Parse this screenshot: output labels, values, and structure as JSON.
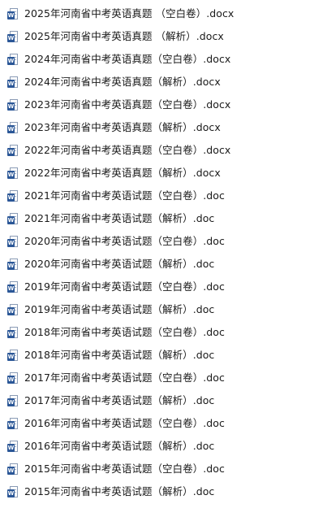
{
  "files": [
    {
      "name": "2025年河南省中考英语真题 （空白卷）.docx",
      "icon": "word-document-icon"
    },
    {
      "name": "2025年河南省中考英语真题 （解析）.docx",
      "icon": "word-document-icon"
    },
    {
      "name": "2024年河南省中考英语真题（空白卷）.docx",
      "icon": "word-document-icon"
    },
    {
      "name": "2024年河南省中考英语真题（解析）.docx",
      "icon": "word-document-icon"
    },
    {
      "name": "2023年河南省中考英语真题（空白卷）.docx",
      "icon": "word-document-icon"
    },
    {
      "name": "2023年河南省中考英语真题（解析）.docx",
      "icon": "word-document-icon"
    },
    {
      "name": "2022年河南省中考英语真题（空白卷）.docx",
      "icon": "word-document-icon"
    },
    {
      "name": "2022年河南省中考英语真题（解析）.docx",
      "icon": "word-document-icon"
    },
    {
      "name": "2021年河南省中考英语试题（空白卷）.doc",
      "icon": "word-document-icon"
    },
    {
      "name": "2021年河南省中考英语试题（解析）.doc",
      "icon": "word-document-icon"
    },
    {
      "name": "2020年河南省中考英语试题（空白卷）.doc",
      "icon": "word-document-icon"
    },
    {
      "name": "2020年河南省中考英语试题（解析）.doc",
      "icon": "word-document-icon"
    },
    {
      "name": "2019年河南省中考英语试题（空白卷）.doc",
      "icon": "word-document-icon"
    },
    {
      "name": "2019年河南省中考英语试题（解析）.doc",
      "icon": "word-document-icon"
    },
    {
      "name": "2018年河南省中考英语试题（空白卷）.doc",
      "icon": "word-document-icon"
    },
    {
      "name": "2018年河南省中考英语试题（解析）.doc",
      "icon": "word-document-icon"
    },
    {
      "name": "2017年河南省中考英语试题（空白卷）.doc",
      "icon": "word-document-icon"
    },
    {
      "name": "2017年河南省中考英语试题（解析）.doc",
      "icon": "word-document-icon"
    },
    {
      "name": "2016年河南省中考英语试题（空白卷）.doc",
      "icon": "word-document-icon"
    },
    {
      "name": "2016年河南省中考英语试题（解析）.doc",
      "icon": "word-document-icon"
    },
    {
      "name": "2015年河南省中考英语试题（空白卷）.doc",
      "icon": "word-document-icon"
    },
    {
      "name": "2015年河南省中考英语试题（解析）.doc",
      "icon": "word-document-icon"
    }
  ],
  "colors": {
    "text": "#1a1a1a",
    "icon_badge": "#2b5797",
    "background": "#ffffff"
  }
}
